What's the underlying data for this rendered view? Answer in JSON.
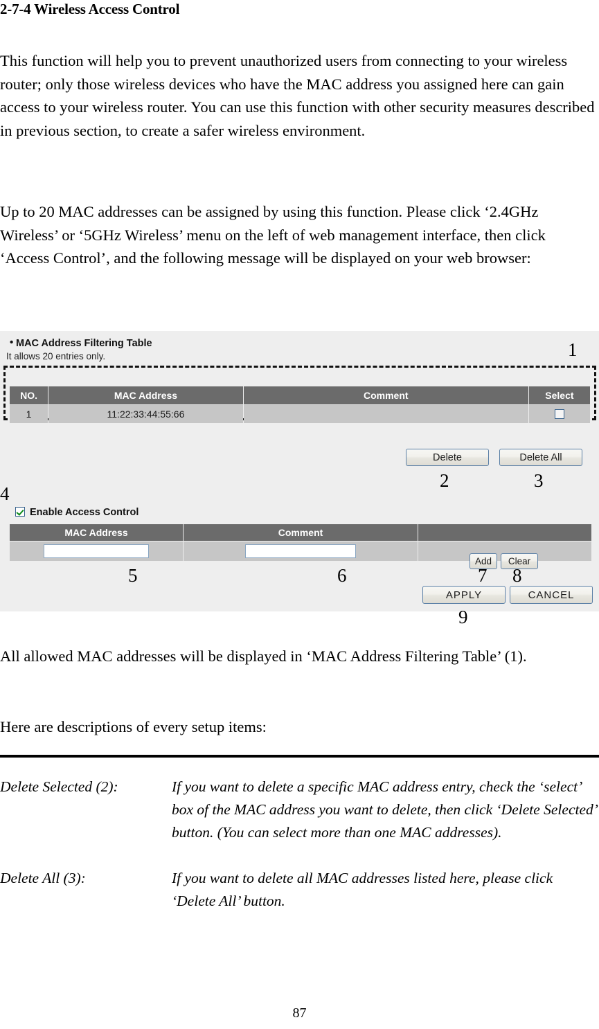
{
  "document": {
    "title": "2-7-4 Wireless Access Control",
    "page_number": "87",
    "paragraphs": {
      "p1": "This function will help you to prevent unauthorized users from connecting to your wireless router; only those wireless devices who have the MAC address you assigned here can gain access to your wireless router. You can use this function with other security measures described in previous section, to create a safer wireless environment.",
      "p2": "Up to 20 MAC addresses can be assigned by using this function. Please click ‘2.4GHz Wireless’ or ‘5GHz Wireless’ menu on the left of web management interface, then click ‘Access Control’, and the following message will be displayed on your web browser:",
      "p3": "All allowed MAC addresses will be displayed in ‘MAC Address Filtering Table’ (1).",
      "p4": "Here are descriptions of every setup items:"
    },
    "definitions": [
      {
        "term": "Delete Selected (2):",
        "body": "If you want to delete a specific MAC address entry, check the ‘select’ box of the MAC address you want to delete, then click ‘Delete Selected’ button. (You can select more than one MAC addresses)."
      },
      {
        "term": "Delete All (3):",
        "body": "If you want to delete all MAC addresses listed here, please click ‘Delete All’ button."
      }
    ]
  },
  "figure": {
    "heading": "MAC Address Filtering Table",
    "subheading": "It allows 20 entries only.",
    "filter_table": {
      "columns": [
        "NO.",
        "MAC Address",
        "Comment",
        "Select"
      ],
      "rows": [
        {
          "no": "1",
          "mac": "11:22:33:44:55:66",
          "comment": "",
          "selected": false
        }
      ]
    },
    "buttons": {
      "delete": "Delete",
      "delete_all": "Delete All",
      "add": "Add",
      "clear": "Clear",
      "apply": "APPLY",
      "cancel": "CANCEL"
    },
    "enable_access_control": {
      "label": "Enable Access Control",
      "checked": true
    },
    "entry_table": {
      "columns": [
        "MAC Address",
        "Comment",
        ""
      ],
      "mac_value": "",
      "comment_value": ""
    },
    "callouts": {
      "c1": "1",
      "c2": "2",
      "c3": "3",
      "c4": "4",
      "c5": "5",
      "c6": "6",
      "c7": "7",
      "c8": "8",
      "c9": "9"
    },
    "colors": {
      "background": "#eeeeee",
      "header_row": "#6b6b6b",
      "data_row": "#c6c6c6",
      "button_border": "#5a7fa6",
      "check_green": "#0a8a17"
    }
  }
}
